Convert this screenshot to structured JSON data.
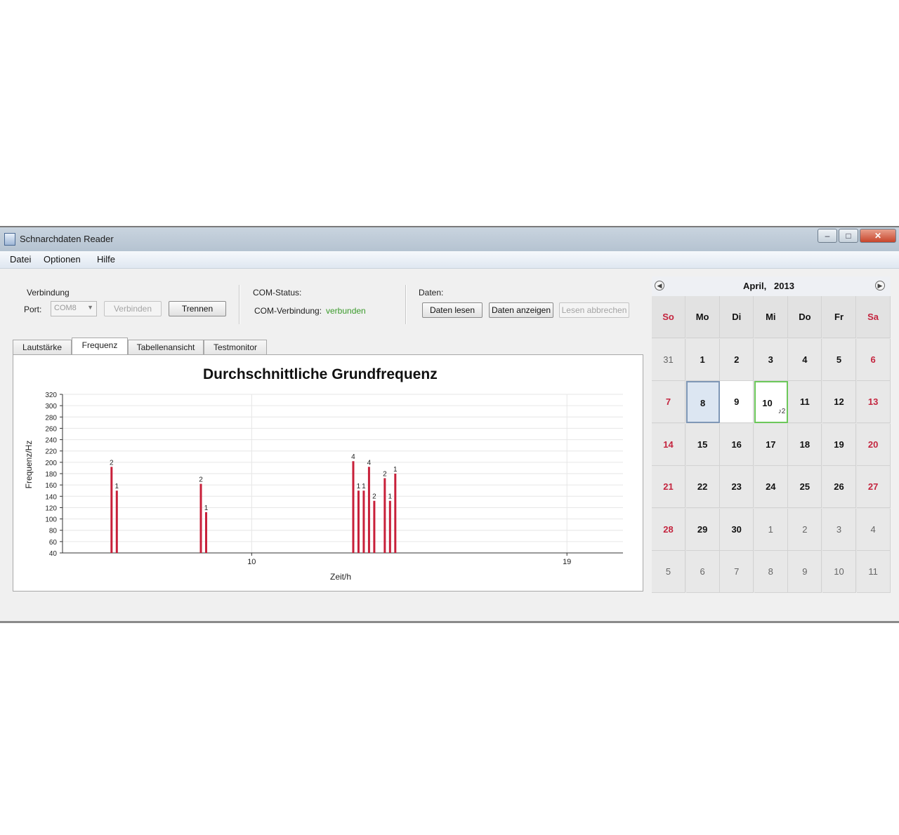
{
  "window": {
    "title": "Schnarchdaten Reader"
  },
  "menu": {
    "items": [
      "Datei",
      "Optionen",
      "Hilfe"
    ]
  },
  "connection": {
    "group_label": "Verbindung",
    "port_label": "Port:",
    "port_value": "COM8",
    "connect_label": "Verbinden",
    "disconnect_label": "Trennen"
  },
  "com_status": {
    "group_label": "COM-Status:",
    "connection_label": "COM-Verbindung:",
    "connection_value": "verbunden",
    "connection_color": "#3a9a2a"
  },
  "data_group": {
    "group_label": "Daten:",
    "read_label": "Daten lesen",
    "show_label": "Daten anzeigen",
    "abort_label": "Lesen abbrechen"
  },
  "tabs": [
    "Lautstärke",
    "Frequenz",
    "Tabellenansicht",
    "Testmonitor"
  ],
  "active_tab": 1,
  "chart_data": {
    "type": "bar",
    "title": "Durchschnittliche Grundfrequenz",
    "xlabel": "Zeit/h",
    "ylabel": "Frequenz/Hz",
    "ylim": [
      40,
      320
    ],
    "yticks": [
      40,
      60,
      80,
      100,
      120,
      140,
      160,
      180,
      200,
      220,
      240,
      260,
      280,
      300,
      320
    ],
    "xlim": [
      4.6,
      20.6
    ],
    "xtick_labels": [
      {
        "x": 10,
        "label": "10"
      },
      {
        "x": 19,
        "label": "19"
      }
    ],
    "bar_color": "#c8203a",
    "bars": [
      {
        "x": 6.0,
        "value": 192,
        "label": "2"
      },
      {
        "x": 6.15,
        "value": 150,
        "label": "1"
      },
      {
        "x": 8.55,
        "value": 162,
        "label": "2"
      },
      {
        "x": 8.7,
        "value": 112,
        "label": "1"
      },
      {
        "x": 12.9,
        "value": 202,
        "label": "4"
      },
      {
        "x": 13.05,
        "value": 150,
        "label": "1"
      },
      {
        "x": 13.2,
        "value": 150,
        "label": "1"
      },
      {
        "x": 13.35,
        "value": 192,
        "label": "4"
      },
      {
        "x": 13.5,
        "value": 132,
        "label": "2"
      },
      {
        "x": 13.8,
        "value": 172,
        "label": "2"
      },
      {
        "x": 13.95,
        "value": 132,
        "label": "1"
      },
      {
        "x": 14.1,
        "value": 180,
        "label": "1"
      }
    ]
  },
  "calendar": {
    "month": "April,",
    "year": "2013",
    "weekdays": [
      "So",
      "Mo",
      "Di",
      "Mi",
      "Do",
      "Fr",
      "Sa"
    ],
    "weeks": [
      [
        "31",
        "1",
        "2",
        "3",
        "4",
        "5",
        "6"
      ],
      [
        "7",
        "8",
        "9",
        "10",
        "11",
        "12",
        "13"
      ],
      [
        "14",
        "15",
        "16",
        "17",
        "18",
        "19",
        "20"
      ],
      [
        "21",
        "22",
        "23",
        "24",
        "25",
        "26",
        "27"
      ],
      [
        "28",
        "29",
        "30",
        "1",
        "2",
        "3",
        "4"
      ],
      [
        "5",
        "6",
        "7",
        "8",
        "9",
        "10",
        "11"
      ]
    ],
    "selected_day": "8",
    "today_day": "10",
    "today_badge": "♪2",
    "weekend_color": "#c4253f"
  }
}
